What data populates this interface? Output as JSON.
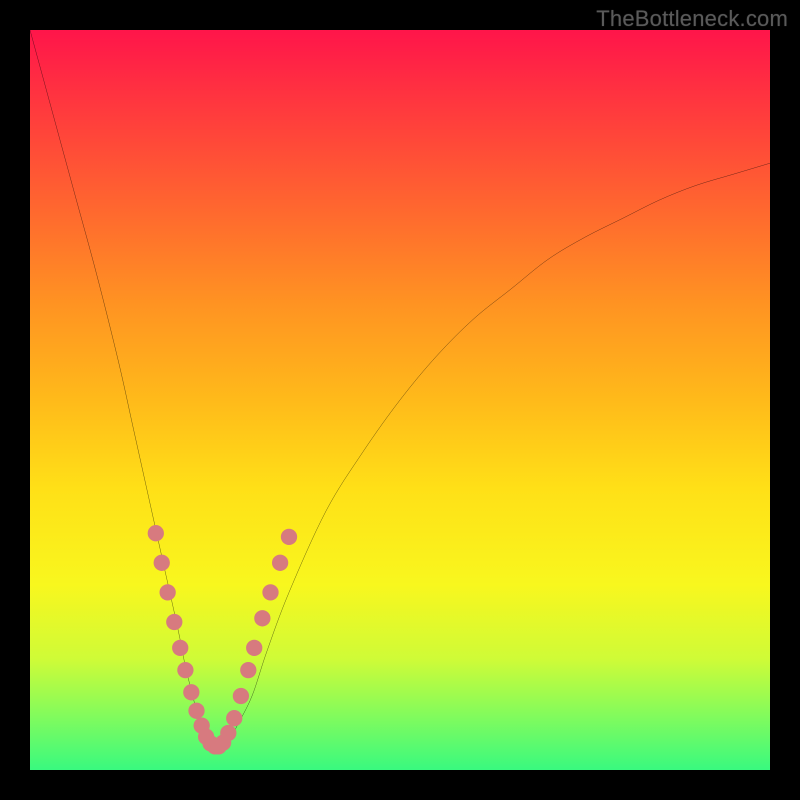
{
  "watermark": "TheBottleneck.com",
  "chart_data": {
    "type": "line",
    "title": "",
    "xlabel": "",
    "ylabel": "",
    "xlim": [
      0,
      100
    ],
    "ylim": [
      0,
      100
    ],
    "series": [
      {
        "name": "curve",
        "x": [
          0,
          3,
          6,
          9,
          12,
          14,
          16,
          18,
          20,
          21,
          22,
          23,
          24,
          25,
          26,
          27,
          28,
          30,
          32,
          35,
          40,
          45,
          50,
          55,
          60,
          65,
          70,
          75,
          80,
          85,
          90,
          95,
          100
        ],
        "values": [
          100,
          89,
          78,
          67,
          55,
          46,
          37,
          28,
          19,
          14,
          10,
          6,
          4,
          3,
          3,
          4,
          6,
          10,
          16,
          24,
          35,
          43,
          50,
          56,
          61,
          65,
          69,
          72,
          74.5,
          77,
          79,
          80.5,
          82
        ]
      }
    ],
    "markers": {
      "name": "dots",
      "color": "#d77a7f",
      "radius": 1.1,
      "points": [
        {
          "x": 17.0,
          "y": 32
        },
        {
          "x": 17.8,
          "y": 28
        },
        {
          "x": 18.6,
          "y": 24
        },
        {
          "x": 19.5,
          "y": 20
        },
        {
          "x": 20.3,
          "y": 16.5
        },
        {
          "x": 21.0,
          "y": 13.5
        },
        {
          "x": 21.8,
          "y": 10.5
        },
        {
          "x": 22.5,
          "y": 8
        },
        {
          "x": 23.2,
          "y": 6
        },
        {
          "x": 23.8,
          "y": 4.5
        },
        {
          "x": 24.4,
          "y": 3.6
        },
        {
          "x": 25.0,
          "y": 3.2
        },
        {
          "x": 25.5,
          "y": 3.2
        },
        {
          "x": 26.1,
          "y": 3.7
        },
        {
          "x": 26.8,
          "y": 5
        },
        {
          "x": 27.6,
          "y": 7
        },
        {
          "x": 28.5,
          "y": 10
        },
        {
          "x": 29.5,
          "y": 13.5
        },
        {
          "x": 30.3,
          "y": 16.5
        },
        {
          "x": 31.4,
          "y": 20.5
        },
        {
          "x": 32.5,
          "y": 24
        },
        {
          "x": 33.8,
          "y": 28
        },
        {
          "x": 35.0,
          "y": 31.5
        }
      ]
    }
  }
}
